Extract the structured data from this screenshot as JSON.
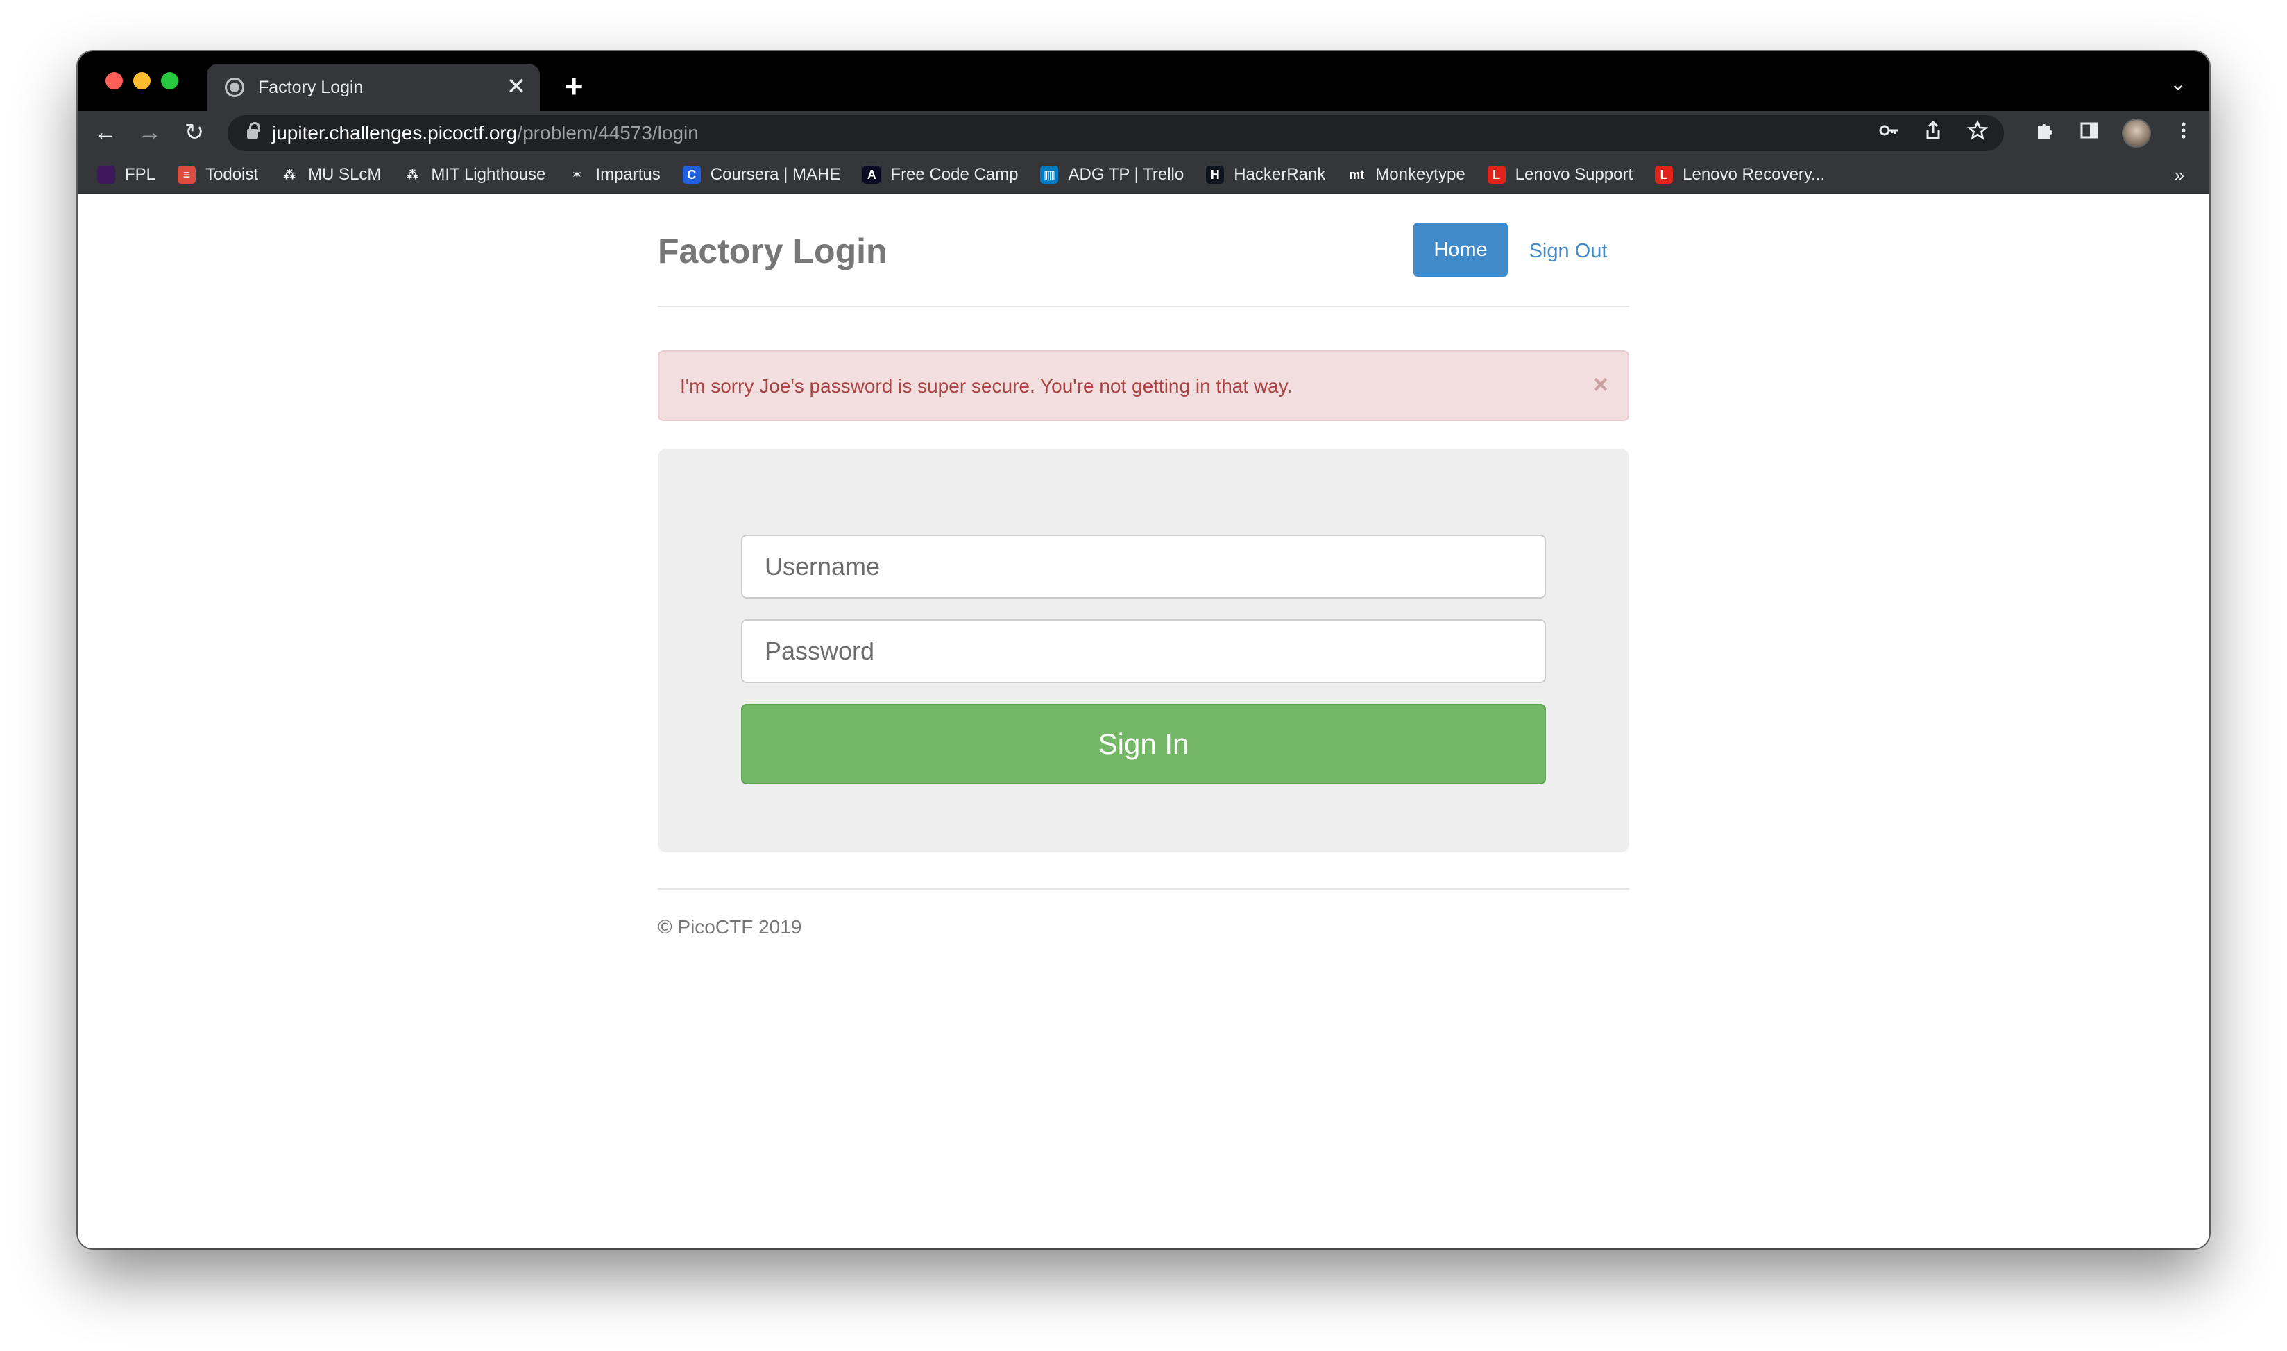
{
  "browser": {
    "tab": {
      "title": "Factory Login",
      "close_glyph": "✕"
    },
    "new_tab_glyph": "+",
    "tab_menu_glyph": "⌄",
    "nav": {
      "back": "←",
      "forward": "→",
      "reload": "↻"
    },
    "url": {
      "host": "jupiter.challenges.picoctf.org",
      "path": "/problem/44573/login"
    },
    "omnibox_icons": [
      "key-icon",
      "share-icon",
      "star-icon"
    ],
    "toolbar_icons": [
      "puzzle-icon",
      "sidebar-icon",
      "avatar",
      "kebab-menu-icon"
    ],
    "bookmarks": [
      {
        "label": "FPL",
        "icon_color": "#3d195b",
        "glyph": ""
      },
      {
        "label": "Todoist",
        "icon_color": "#db4c3f",
        "glyph": "≡"
      },
      {
        "label": "MU SLcM",
        "icon_color": "#35363a",
        "glyph": "⁂"
      },
      {
        "label": "MIT Lighthouse",
        "icon_color": "#35363a",
        "glyph": "⁂"
      },
      {
        "label": "Impartus",
        "icon_color": "#35363a",
        "glyph": "✶"
      },
      {
        "label": "Coursera | MAHE",
        "icon_color": "#1f5fe0",
        "glyph": "C"
      },
      {
        "label": "Free Code Camp",
        "icon_color": "#0a0a23",
        "glyph": "A"
      },
      {
        "label": "ADG TP | Trello",
        "icon_color": "#0079bf",
        "glyph": "▥"
      },
      {
        "label": "HackerRank",
        "icon_color": "#0e141e",
        "glyph": "H"
      },
      {
        "label": "Monkeytype",
        "icon_color": "#35363a",
        "glyph": "mt"
      },
      {
        "label": "Lenovo Support",
        "icon_color": "#e2231a",
        "glyph": "L"
      },
      {
        "label": "Lenovo Recovery...",
        "icon_color": "#e2231a",
        "glyph": "L"
      }
    ],
    "bookmarks_overflow": "»"
  },
  "page": {
    "brand": "Factory Login",
    "nav": {
      "home": "Home",
      "sign_out": "Sign Out"
    },
    "alert": {
      "message": "I'm sorry Joe's password is super secure. You're not getting in that way.",
      "close": "×"
    },
    "form": {
      "username_placeholder": "Username",
      "password_placeholder": "Password",
      "submit": "Sign In"
    },
    "footer": "© PicoCTF 2019"
  },
  "colors": {
    "primary": "#428bca",
    "success": "#74b767",
    "alert_bg": "#f2dede",
    "alert_text": "#a94442"
  }
}
